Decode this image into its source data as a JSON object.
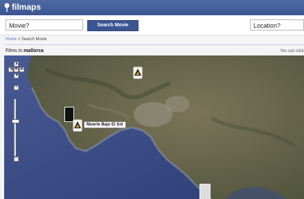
{
  "header": {
    "logo_text": "filmaps"
  },
  "search": {
    "movie_placeholder": "Movie?",
    "button_label": "Search Movie",
    "location_placeholder": "Location?"
  },
  "breadcrumb": {
    "home": "Home",
    "separator": ">",
    "current": "Search Movie"
  },
  "results": {
    "prefix": "Films in",
    "location": "mallorca",
    "hint": "You can click"
  },
  "map": {
    "controls": {
      "up": "▲",
      "down": "▼",
      "left": "◄",
      "right": "►",
      "center": "✥",
      "zoom_in": "+",
      "zoom_out": "−"
    },
    "tooltip": "Muerte Bajo El Sol"
  },
  "colors": {
    "header": "#3b5593",
    "sea": "#33457f",
    "land": "#6b6a4f"
  }
}
